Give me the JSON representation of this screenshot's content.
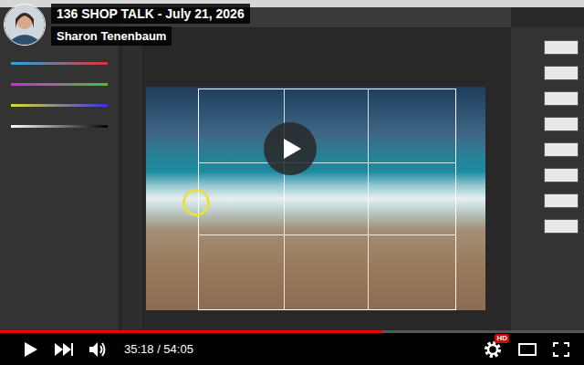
{
  "video": {
    "title": "136 SHOP TALK - July 21, 2026",
    "channel": "Sharon Tenenbaum"
  },
  "player": {
    "paused": true,
    "progress": {
      "level": 0.653
    },
    "time": "35:18 / 54:05",
    "quality_badge": "HD"
  }
}
